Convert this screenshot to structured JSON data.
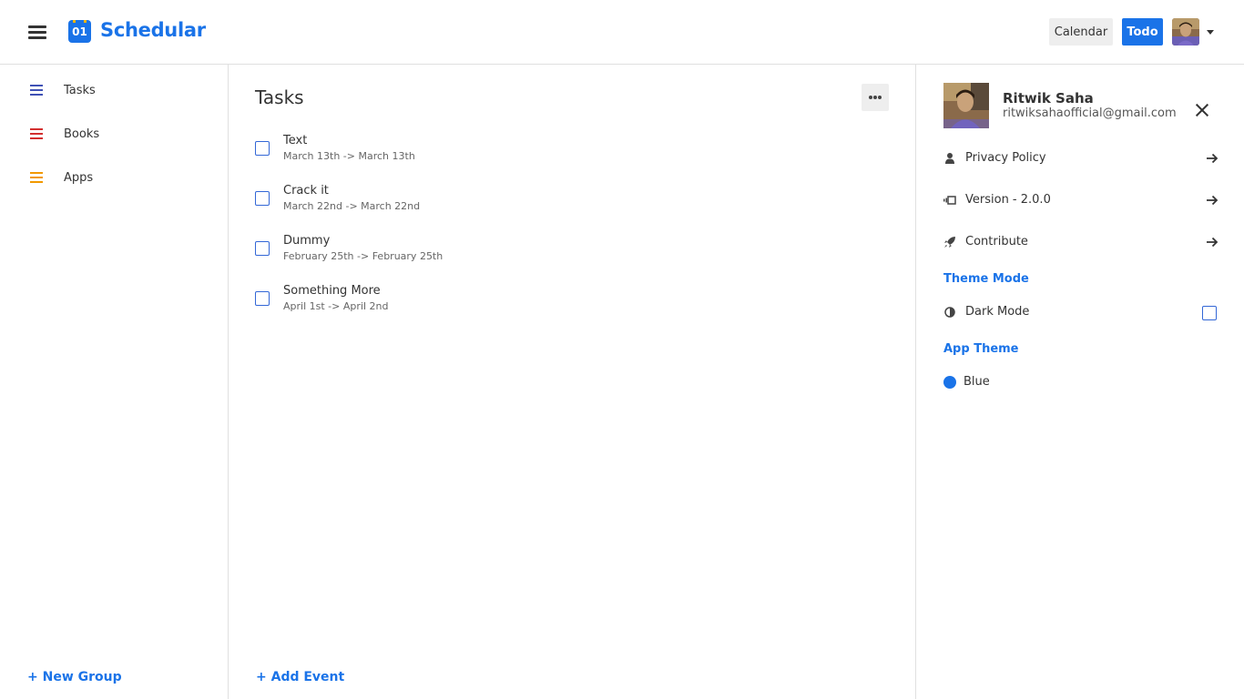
{
  "header": {
    "logo_number": "01",
    "app_title": "Schedular",
    "calendar_label": "Calendar",
    "todo_label": "Todo"
  },
  "sidebar": {
    "groups": [
      {
        "label": "Tasks",
        "color": "#3f51b5"
      },
      {
        "label": "Books",
        "color": "#d32f2f"
      },
      {
        "label": "Apps",
        "color": "#f29900"
      }
    ],
    "new_group_label": "+ New Group"
  },
  "main": {
    "title": "Tasks",
    "tasks": [
      {
        "name": "Text",
        "dates": "March 13th  ->  March 13th",
        "checked": false
      },
      {
        "name": "Crack it",
        "dates": "March 22nd  ->  March 22nd",
        "checked": false
      },
      {
        "name": "Dummy",
        "dates": "February 25th  ->  February 25th",
        "checked": false
      },
      {
        "name": "Something More",
        "dates": "April 1st  ->  April 2nd",
        "checked": false
      }
    ],
    "add_event_label": "+ Add Event"
  },
  "panel": {
    "user_name": "Ritwik Saha",
    "user_email": "ritwiksahaofficial@gmail.com",
    "menu": [
      {
        "label": "Privacy Policy",
        "icon": "person-icon"
      },
      {
        "label": "Version - 2.0.0",
        "icon": "version-icon"
      },
      {
        "label": "Contribute",
        "icon": "rocket-icon"
      }
    ],
    "theme_mode_heading": "Theme Mode",
    "dark_mode_label": "Dark Mode",
    "dark_mode_checked": false,
    "app_theme_heading": "App Theme",
    "theme_name": "Blue",
    "theme_color": "#1a73e8"
  },
  "colors": {
    "accent": "#1a73e8"
  }
}
